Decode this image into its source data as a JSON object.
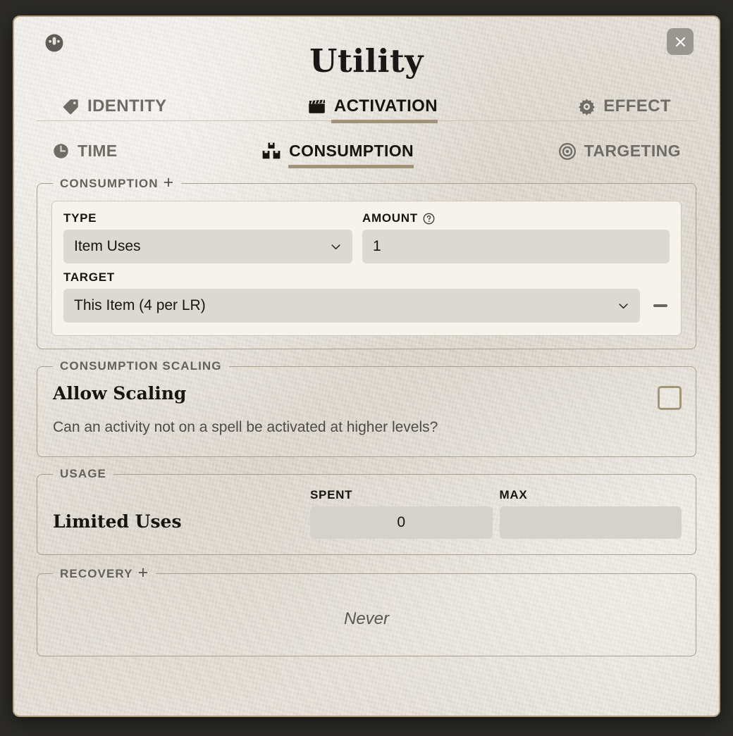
{
  "window": {
    "title": "Utility",
    "document_icon": "gauge-icon",
    "close_label": "✕"
  },
  "tabs_primary": [
    {
      "label": "IDENTITY",
      "icon": "tag-icon",
      "active": false
    },
    {
      "label": "ACTIVATION",
      "icon": "clapperboard-icon",
      "active": true
    },
    {
      "label": "EFFECT",
      "icon": "gear-icon",
      "active": false
    }
  ],
  "tabs_secondary": [
    {
      "label": "TIME",
      "icon": "clock-icon",
      "active": false
    },
    {
      "label": "CONSUMPTION",
      "icon": "boxes-icon",
      "active": true
    },
    {
      "label": "TARGETING",
      "icon": "target-icon",
      "active": false
    }
  ],
  "consumption": {
    "legend": "CONSUMPTION",
    "add_label": "+",
    "type_label": "TYPE",
    "type_value": "Item Uses",
    "amount_label": "AMOUNT",
    "amount_help": "?",
    "amount_value": "1",
    "target_label": "TARGET",
    "target_value": "This Item (4 per LR)",
    "remove_label": "—"
  },
  "scaling": {
    "legend": "CONSUMPTION SCALING",
    "title": "Allow Scaling",
    "hint": "Can an activity not on a spell be activated at higher levels?",
    "checked": false
  },
  "usage": {
    "legend": "USAGE",
    "title": "Limited Uses",
    "spent_label": "SPENT",
    "spent_value": "0",
    "max_label": "MAX",
    "max_value": "",
    "max_placeholder": ""
  },
  "recovery": {
    "legend": "RECOVERY",
    "add_label": "+",
    "empty_text": "Never"
  },
  "colors": {
    "accent": "#a0937a",
    "panel_border": "#a9a090",
    "checkbox_border": "#a39577",
    "paper": "#e3ded5",
    "backdrop": "#2c2b29"
  }
}
